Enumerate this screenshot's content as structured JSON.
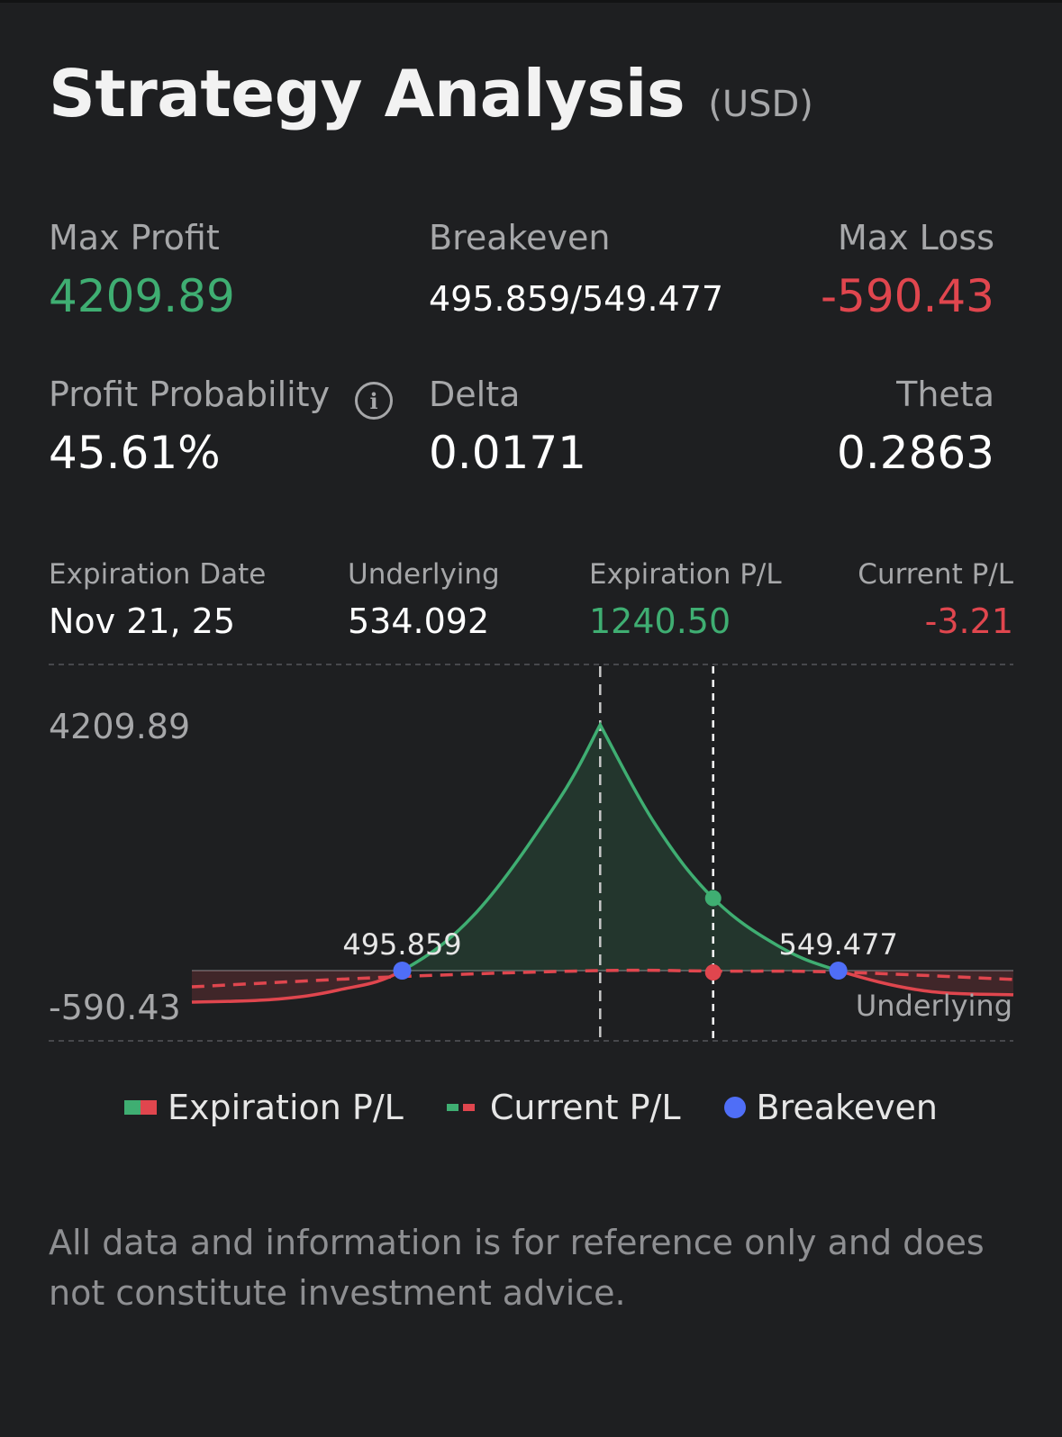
{
  "header": {
    "title": "Strategy Analysis",
    "unit": "(USD)"
  },
  "stats": {
    "max_profit": {
      "label": "Max Profit",
      "value": "4209.89"
    },
    "breakeven": {
      "label": "Breakeven",
      "value": "495.859/549.477"
    },
    "max_loss": {
      "label": "Max Loss",
      "value": "-590.43"
    },
    "profit_probability": {
      "label": "Profit Probability",
      "value": "45.61%"
    },
    "delta": {
      "label": "Delta",
      "value": "0.0171"
    },
    "theta": {
      "label": "Theta",
      "value": "0.2863"
    }
  },
  "snapshot": {
    "expiration_date": {
      "label": "Expiration Date",
      "value": "Nov 21, 25"
    },
    "underlying": {
      "label": "Underlying",
      "value": "534.092"
    },
    "expiration_pl": {
      "label": "Expiration P/L",
      "value": "1240.50"
    },
    "current_pl": {
      "label": "Current P/L",
      "value": "-3.21"
    }
  },
  "legend": {
    "expiration": "Expiration P/L",
    "current": "Current P/L",
    "breakeven": "Breakeven"
  },
  "colors": {
    "profit": "#3fae72",
    "loss": "#e0464e",
    "breakeven": "#4f6ef7",
    "background": "#1e1f21"
  },
  "disclaimer": "All data and information is for reference only and does not constitute investment advice.",
  "chart_data": {
    "type": "line",
    "xlabel": "Underlying",
    "ylim": [
      -590.43,
      4209.89
    ],
    "y_tick_labels": [
      "4209.89",
      "-590.43"
    ],
    "breakevens": [
      {
        "x": 495.859,
        "label": "495.859"
      },
      {
        "x": 549.477,
        "label": "549.477"
      }
    ],
    "peak_x": 520.2,
    "underlying_x": 534.092,
    "underlying_expiration_pl": 1240.5,
    "underlying_current_pl": -3.21,
    "series": [
      {
        "name": "Expiration P/L",
        "x": [
          470,
          480,
          488,
          495.859,
          505,
          515,
          520.2,
          527,
          534.092,
          542,
          549.477,
          560,
          571
        ],
        "y": [
          -470,
          -430,
          -290,
          0,
          1000,
          2900,
          4209.89,
          2500,
          1240.5,
          430,
          0,
          -300,
          -360
        ]
      },
      {
        "name": "Current P/L",
        "x": [
          470,
          495.859,
          520.2,
          534.092,
          549.477,
          571
        ],
        "y": [
          -110,
          -40,
          0,
          -3.21,
          -10,
          -60
        ]
      }
    ]
  }
}
